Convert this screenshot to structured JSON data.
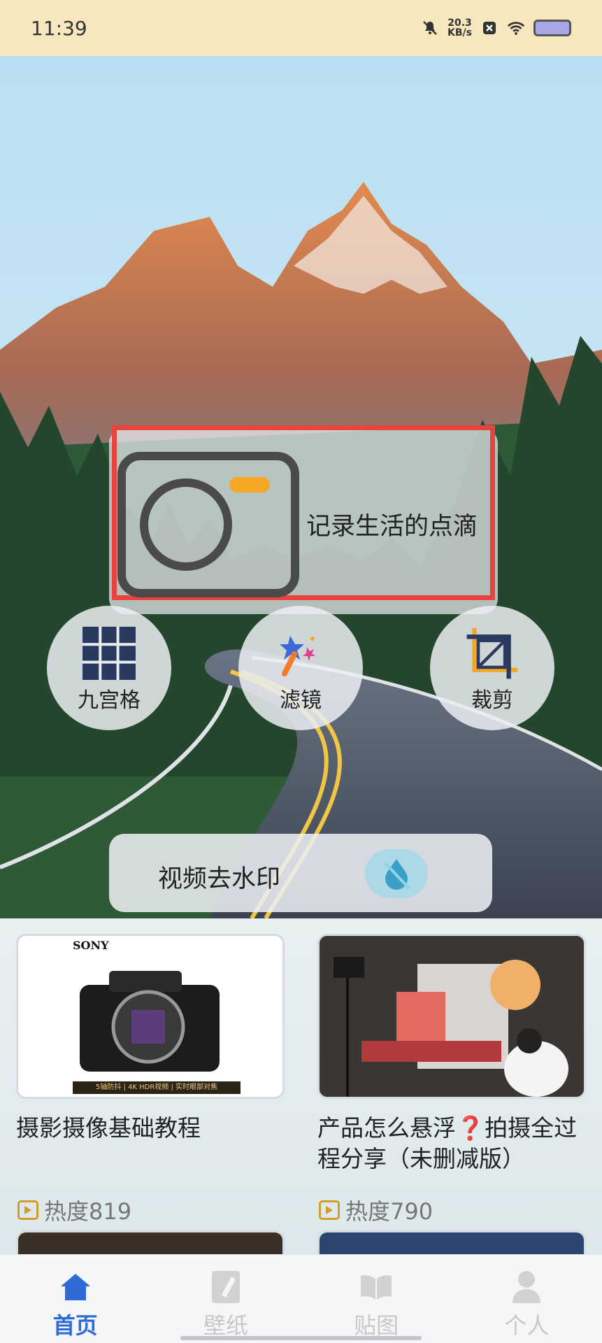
{
  "status_bar": {
    "time": "11:39",
    "net_speed_value": "20.3",
    "net_speed_unit": "KB/s",
    "icons": [
      "mute-bell-icon",
      "close-box-icon",
      "wifi-icon",
      "battery-icon"
    ]
  },
  "hero": {
    "record_label": "记录生活的点滴",
    "tools": [
      {
        "label": "九宫格",
        "icon": "grid-icon"
      },
      {
        "label": "滤镜",
        "icon": "magic-wand-icon"
      },
      {
        "label": "裁剪",
        "icon": "crop-icon"
      }
    ],
    "watermark_label": "视频去水印",
    "colors": {
      "accent_red": "#e8443d",
      "camera_orange": "#f5a623"
    }
  },
  "feed": {
    "items": [
      {
        "title": "摄影摄像基础教程",
        "heat": "热度819",
        "brand": "SONY",
        "banner": "5轴防抖 | 4K HDR视频 | 实时眼部对焦"
      },
      {
        "title": "产品怎么悬浮❓拍摄全过程分享（未删减版）",
        "heat": "热度790"
      }
    ]
  },
  "bottom_nav": {
    "items": [
      {
        "label": "首页",
        "icon": "home-icon",
        "active": true
      },
      {
        "label": "壁纸",
        "icon": "wallpaper-icon",
        "active": false
      },
      {
        "label": "贴图",
        "icon": "book-icon",
        "active": false
      },
      {
        "label": "个人",
        "icon": "person-icon",
        "active": false
      }
    ],
    "active_color": "#2e6bd6"
  }
}
